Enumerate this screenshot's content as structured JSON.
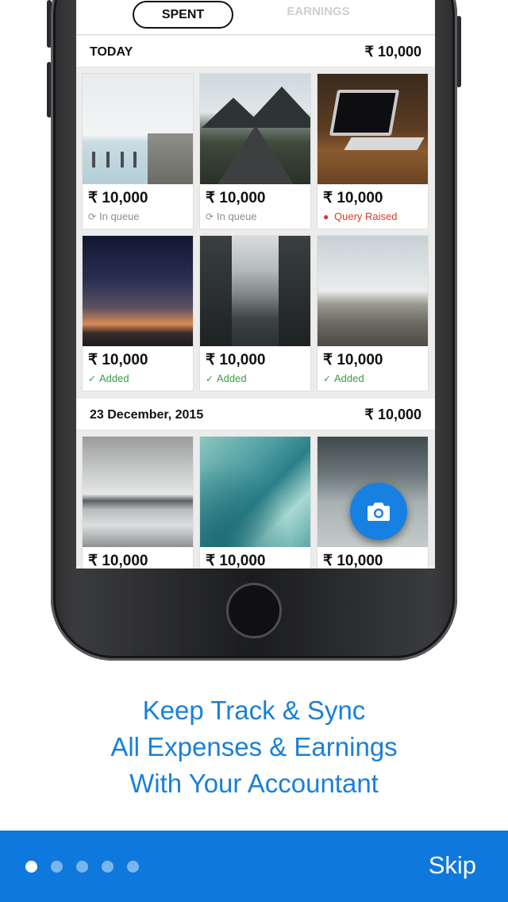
{
  "tabs": {
    "spent": "SPENT",
    "earnings": "EARNINGS"
  },
  "sections": [
    {
      "date": "TODAY",
      "total": "₹ 10,000"
    },
    {
      "date": "23 December, 2015",
      "total": "₹ 10,000"
    }
  ],
  "cards": [
    {
      "amount": "₹ 10,000",
      "status": "In queue",
      "status_icon": "sync-icon"
    },
    {
      "amount": "₹ 10,000",
      "status": "In queue",
      "status_icon": "sync-icon"
    },
    {
      "amount": "₹ 10,000",
      "status": "Query Raised",
      "status_icon": "alert-icon"
    },
    {
      "amount": "₹ 10,000",
      "status": "Added",
      "status_icon": "double-check-icon"
    },
    {
      "amount": "₹ 10,000",
      "status": "Added",
      "status_icon": "double-check-icon"
    },
    {
      "amount": "₹ 10,000",
      "status": "Added",
      "status_icon": "double-check-icon"
    },
    {
      "amount": "₹ 10,000"
    },
    {
      "amount": "₹ 10,000"
    },
    {
      "amount": "₹ 10,000"
    }
  ],
  "fab": {
    "icon": "camera-icon"
  },
  "tagline": {
    "line1": "Keep Track & Sync",
    "line2": "All Expenses  & Earnings",
    "line3": "With Your Accountant"
  },
  "footer": {
    "skip_label": "Skip",
    "page_count": 5,
    "active_page": 1
  },
  "colors": {
    "brand_blue": "#0f78dc",
    "query_red": "#d63a2a",
    "added_green": "#3b9a45",
    "queue_gray": "#8d8d8d"
  }
}
